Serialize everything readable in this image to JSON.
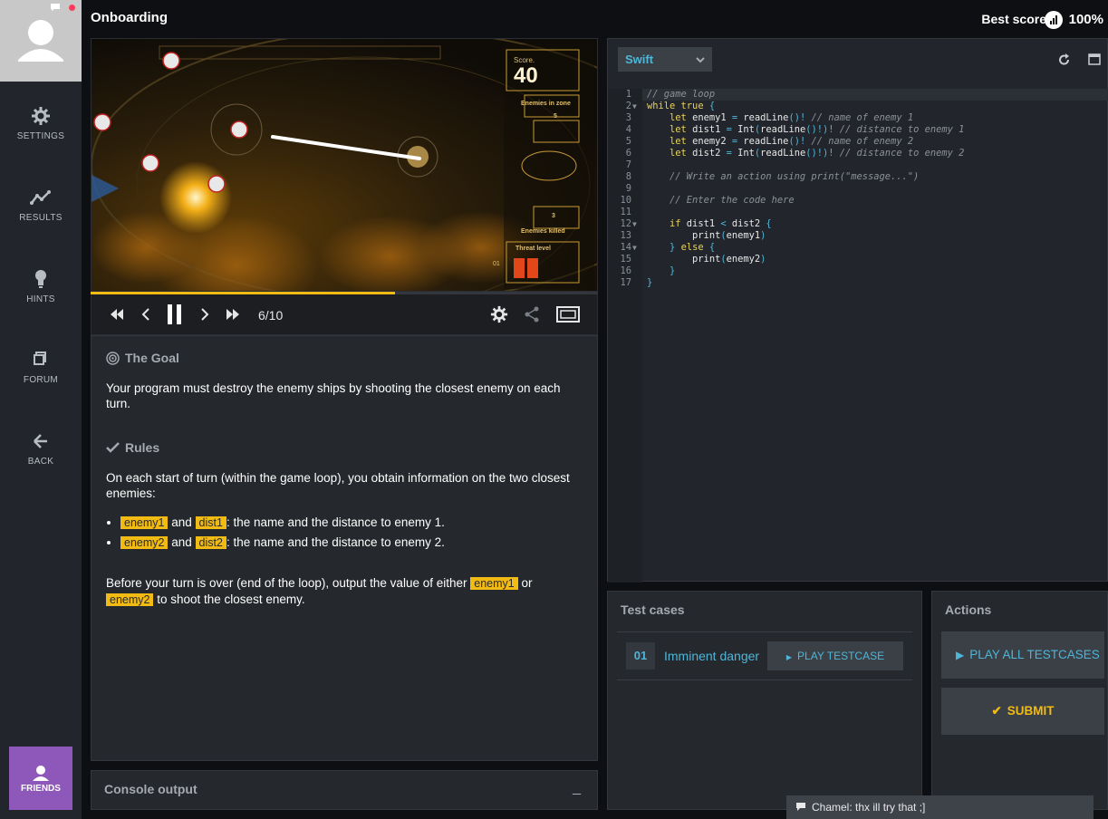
{
  "app": {
    "title": "Onboarding"
  },
  "score": {
    "label": "Best score",
    "value": "100%"
  },
  "sidebar": {
    "items": [
      {
        "label": "SETTINGS",
        "icon": "gear-icon"
      },
      {
        "label": "RESULTS",
        "icon": "chart-line-icon"
      },
      {
        "label": "HINTS",
        "icon": "lightbulb-icon"
      },
      {
        "label": "FORUM",
        "icon": "forum-icon"
      },
      {
        "label": "BACK",
        "icon": "arrow-left-icon"
      }
    ],
    "friends_label": "FRIENDS"
  },
  "viewer": {
    "hud": {
      "score_label": "Score.",
      "score_value": "40",
      "enemies_in_zone_label": "Enemies in zone",
      "enemies_in_zone_value": "5",
      "enemies_killed_label": "Enemies killed",
      "enemies_killed_value": "3",
      "threat_label": "Threat level",
      "threat_value": "01"
    },
    "progress": 0.6,
    "frame_counter": "6/10"
  },
  "statement": {
    "goal_title": "The Goal",
    "goal_text": "Your program must destroy the enemy ships by shooting the closest enemy on each turn.",
    "rules_title": "Rules",
    "rules_intro": "On each start of turn (within the game loop), you obtain information on the two closest enemies:",
    "bullets": [
      {
        "var1": "enemy1",
        "and": "and",
        "var2": "dist1",
        "text": ": the name and the distance to enemy 1."
      },
      {
        "var1": "enemy2",
        "and": "and",
        "var2": "dist2",
        "text": ": the name and the distance to enemy 2."
      }
    ],
    "end_text_1": "Before your turn is over (end of the loop), output the value of either",
    "end_var1": "enemy1",
    "end_or": "or",
    "end_var2": "enemy2",
    "end_text_2": "to shoot the closest enemy."
  },
  "console": {
    "title": "Console output",
    "minimize": "_"
  },
  "editor": {
    "language": "Swift",
    "line_numbers": [
      "1",
      "2",
      "3",
      "4",
      "5",
      "6",
      "7",
      "8",
      "9",
      "10",
      "11",
      "12",
      "13",
      "14",
      "15",
      "16",
      "17"
    ]
  },
  "testcases": {
    "title": "Test cases",
    "items": [
      {
        "number": "01",
        "name": "Imminent danger",
        "play_label": "PLAY TESTCASE"
      }
    ]
  },
  "actions": {
    "title": "Actions",
    "play_all_label": "PLAY ALL TESTCASES",
    "submit_label": "SUBMIT"
  },
  "chat": {
    "message": "Chamel: thx ill try that ;]"
  },
  "colors": {
    "accent": "#f2bb13",
    "link": "#4fb6d8",
    "friends": "#8d58b9"
  }
}
